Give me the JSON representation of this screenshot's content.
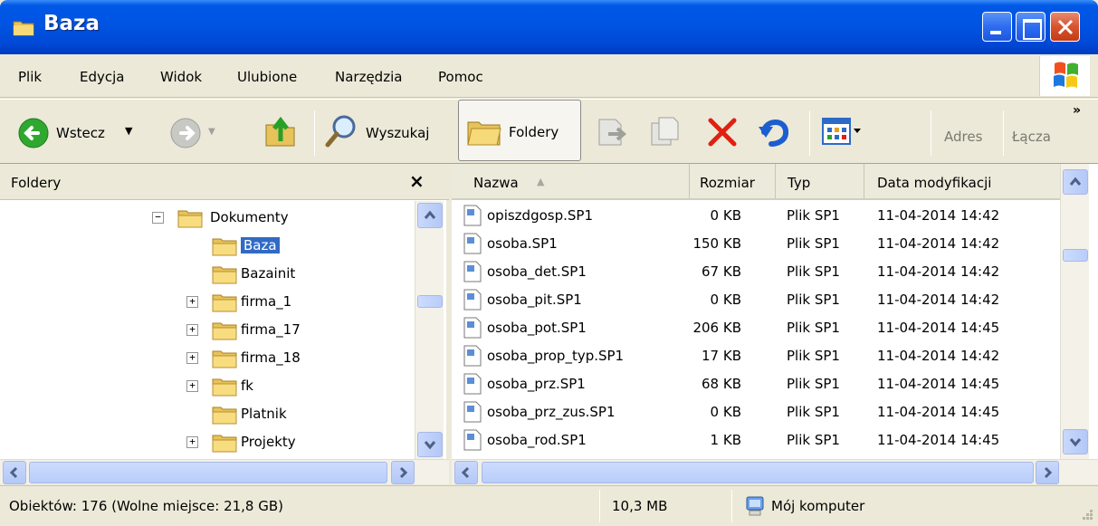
{
  "window": {
    "title": "Baza"
  },
  "menu": [
    "Plik",
    "Edycja",
    "Widok",
    "Ulubione",
    "Narzędzia",
    "Pomoc"
  ],
  "toolbar": {
    "back_label": "Wstecz",
    "search_label": "Wyszukaj",
    "folders_label": "Foldery",
    "address_label": "Adres",
    "links_label": "Łącza"
  },
  "folders_pane": {
    "title": "Foldery",
    "items": [
      {
        "label": "Dokumenty",
        "expander": "−",
        "selected": false
      },
      {
        "label": "Baza",
        "expander": "",
        "selected": true
      },
      {
        "label": "Bazainit",
        "expander": "",
        "selected": false
      },
      {
        "label": "firma_1",
        "expander": "+",
        "selected": false
      },
      {
        "label": "firma_17",
        "expander": "+",
        "selected": false
      },
      {
        "label": "firma_18",
        "expander": "+",
        "selected": false
      },
      {
        "label": "fk",
        "expander": "+",
        "selected": false
      },
      {
        "label": "Platnik",
        "expander": "",
        "selected": false
      },
      {
        "label": "Projekty",
        "expander": "+",
        "selected": false
      }
    ]
  },
  "file_list": {
    "columns": [
      "Nazwa",
      "Rozmiar",
      "Typ",
      "Data modyfikacji"
    ],
    "rows": [
      {
        "name": "opiszdgosp.SP1",
        "size": "0 KB",
        "type": "Plik SP1",
        "date": "11-04-2014 14:42"
      },
      {
        "name": "osoba.SP1",
        "size": "150 KB",
        "type": "Plik SP1",
        "date": "11-04-2014 14:42"
      },
      {
        "name": "osoba_det.SP1",
        "size": "67 KB",
        "type": "Plik SP1",
        "date": "11-04-2014 14:42"
      },
      {
        "name": "osoba_pit.SP1",
        "size": "0 KB",
        "type": "Plik SP1",
        "date": "11-04-2014 14:42"
      },
      {
        "name": "osoba_pot.SP1",
        "size": "206 KB",
        "type": "Plik SP1",
        "date": "11-04-2014 14:45"
      },
      {
        "name": "osoba_prop_typ.SP1",
        "size": "17 KB",
        "type": "Plik SP1",
        "date": "11-04-2014 14:42"
      },
      {
        "name": "osoba_prz.SP1",
        "size": "68 KB",
        "type": "Plik SP1",
        "date": "11-04-2014 14:45"
      },
      {
        "name": "osoba_prz_zus.SP1",
        "size": "0 KB",
        "type": "Plik SP1",
        "date": "11-04-2014 14:45"
      },
      {
        "name": "osoba_rod.SP1",
        "size": "1 KB",
        "type": "Plik SP1",
        "date": "11-04-2014 14:45"
      }
    ]
  },
  "status": {
    "objects": "Obiektów: 176 (Wolne miejsce: 21,8 GB)",
    "size": "10,3 MB",
    "location": "Mój komputer"
  },
  "colors": {
    "title_bar": "#0054e3",
    "selection": "#316ac5",
    "delete_icon": "#e02010"
  },
  "icons": [
    "back-arrow-icon",
    "forward-arrow-icon",
    "up-folder-icon",
    "search-magnifier-icon",
    "folders-icon",
    "move-to-icon",
    "copy-to-icon",
    "delete-icon",
    "undo-icon",
    "views-icon",
    "computer-icon"
  ]
}
